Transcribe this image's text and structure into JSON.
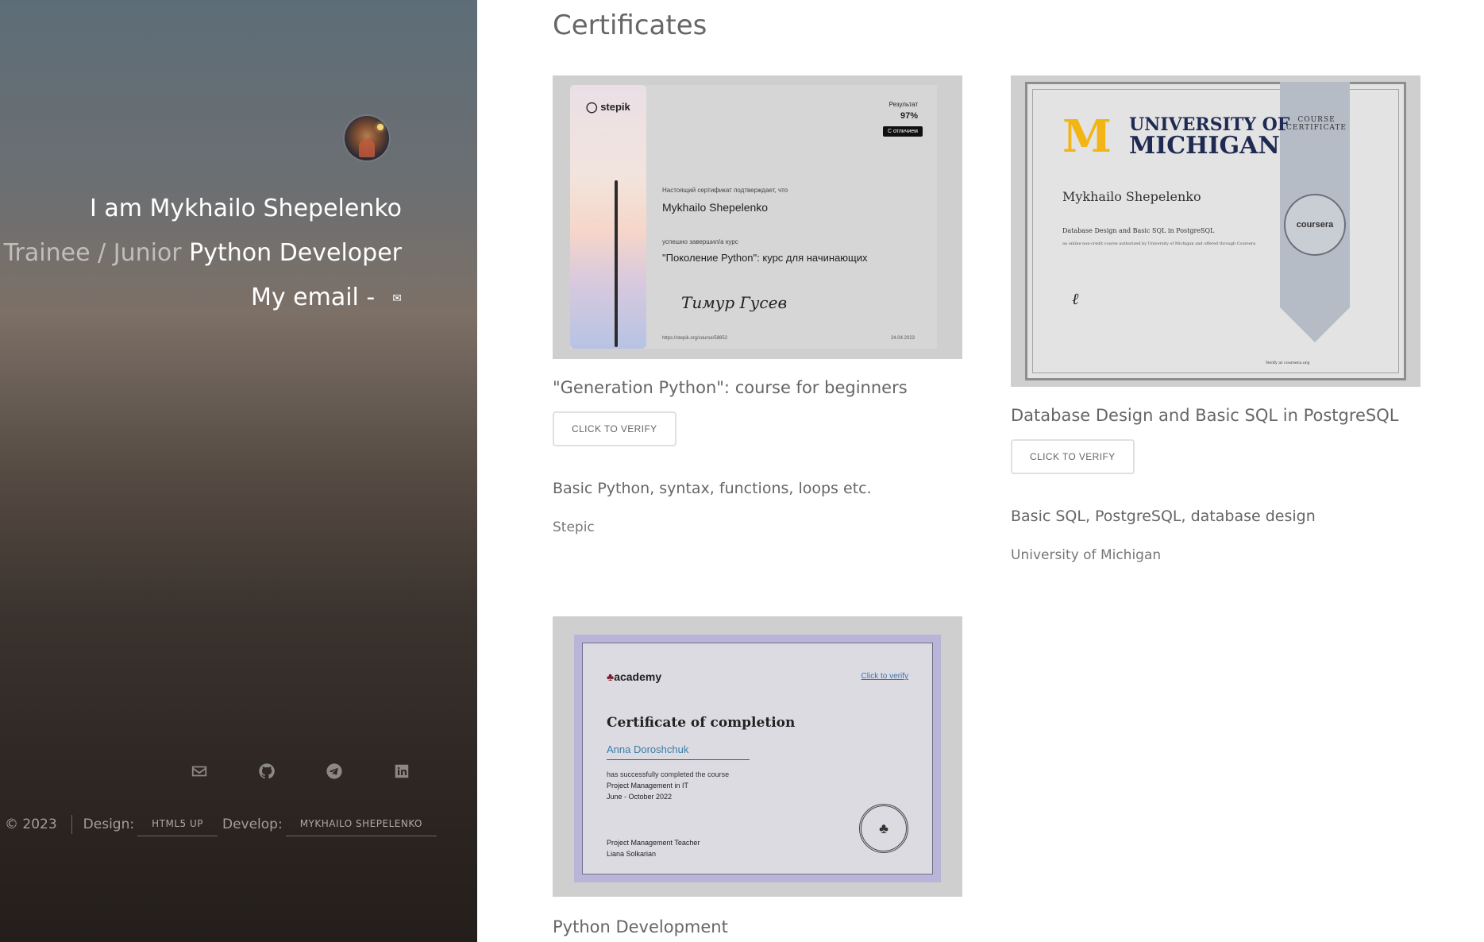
{
  "sidebar": {
    "intro": {
      "name": "I am Mykhailo Shepelenko",
      "role_muted": "Trainee / Junior",
      "role": "Python Developer",
      "email_label": "My email -"
    },
    "social_icons": [
      "envelope-icon",
      "github-icon",
      "telegram-icon",
      "linkedin-icon"
    ],
    "footer": {
      "copyright": "© 2023",
      "design_label": "Design:",
      "design_link": "HTML5 UP",
      "develop_label": "Develop:",
      "develop_link": "MYKHAILO SHEPELENKO"
    }
  },
  "main": {
    "section_title": "Certificates",
    "certificates": [
      {
        "title": "\"Generation Python\": course for beginners",
        "verify_label": "CLICK TO VERIFY",
        "description": "Basic Python, syntax, functions, loops etc.",
        "issuer": "Stepic",
        "image": {
          "logo": "stepik",
          "result_label": "Результат",
          "result_value": "97%",
          "badge": "С отличием",
          "line1": "Настоящий сертификат подтверждает, что",
          "name": "Mykhailo Shepelenko",
          "line2": "успешно завершил/а курс",
          "course": "\"Поколение Python\": курс для начинающих",
          "signature": "Тимур Гусев",
          "date": "24.04.2023",
          "url": "https://stepik.org/course/58852"
        }
      },
      {
        "title": "Database Design and Basic SQL in PostgreSQL",
        "verify_label": "CLICK TO VERIFY",
        "description": "Basic SQL, PostgreSQL, database design",
        "issuer": "University of Michigan",
        "image": {
          "uni_line1": "UNIVERSITY OF",
          "uni_line2": "MICHIGAN",
          "course_certificate": "COURSE CERTIFICATE",
          "name": "Mykhailo Shepelenko",
          "course": "Database Design and Basic SQL in PostgreSQL",
          "small": "an online non-credit course authorized by University of Michigan and offered through Coursera",
          "seal": "coursera",
          "verify": "Verify at coursera.org"
        }
      },
      {
        "title": "Python Development",
        "image": {
          "logo": "academy",
          "link": "Click to verify",
          "cert_title": "Certificate of completion",
          "name": "Anna Doroshchuk",
          "line1": "has successfully completed the course",
          "course": "Project Management in IT",
          "dates": "June - October 2022",
          "teacher_role": "Project Management Teacher",
          "teacher": "Liana Solkarian"
        }
      }
    ]
  }
}
